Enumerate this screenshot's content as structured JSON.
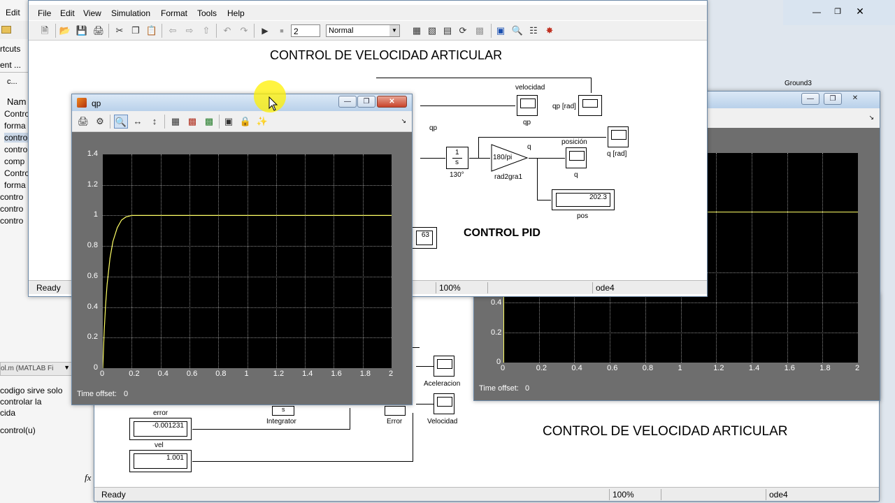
{
  "colors": {
    "plot_bg": "#000000",
    "trace": "#ffff66",
    "titlebar": "#c8daee"
  },
  "matlab": {
    "menu_edit": "Edit",
    "shortcuts": "rtcuts",
    "current_dir": "ent ...",
    "path_back": "c...",
    "col_name": "Nam",
    "files": [
      "Contro",
      "forma",
      "contro",
      "contro",
      "comp",
      "Contro",
      "forma",
      "contro",
      "contro",
      "contro"
    ],
    "editor_file": "ol.m (MATLAB Fi",
    "editor_lines": [
      "codigo sirve solo",
      "controlar la",
      "cida",
      "control(u)"
    ],
    "fx": "fx"
  },
  "model_top": {
    "menus": [
      "File",
      "Edit",
      "View",
      "Simulation",
      "Format",
      "Tools",
      "Help"
    ],
    "stop_time": "2",
    "sim_mode": "Normal",
    "title": "CONTROL DE VELOCIDAD ARTICULAR",
    "subtitle": "CONTROL PID",
    "status_ready": "Ready",
    "zoom": "100%",
    "solver": "ode4",
    "blocks": {
      "velocidad": "velocidad",
      "qp": "qp",
      "qp_rad": "qp [rad]",
      "qp_signal": "qp",
      "integ_num": "1",
      "integ_den": "s",
      "integ_label": "130°",
      "gain": "180/pi",
      "gain_label": "rad2gra1",
      "q_signal": "q",
      "posicion": "posición",
      "q": "q",
      "q_rad": "q [rad]",
      "pos_value": "202.3",
      "pos": "pos",
      "partial_value": "63"
    }
  },
  "ground3": "Ground3",
  "scope_qp": {
    "title": "qp",
    "time_offset_label": "Time offset:",
    "time_offset_value": "0"
  },
  "scope_right": {
    "time_offset_label": "Time offset:",
    "time_offset_value": "0",
    "y_ticks": [
      "0.4",
      "0.2",
      "0"
    ],
    "x_ticks": [
      "0",
      "0.2",
      "0.4",
      "0.6",
      "0.8",
      "1",
      "1.2",
      "1.4",
      "1.6",
      "1.8",
      "2"
    ]
  },
  "model_bottom": {
    "title": "CONTROL DE VELOCIDAD ARTICULAR",
    "error_label": "error",
    "error_value": "-0.001231",
    "vel_label": "vel",
    "vel_value": "1.001",
    "integrator_s": "s",
    "integrator": "Integrator",
    "error_block": "Error",
    "aceleracion": "Aceleracion",
    "velocidad": "Velocidad",
    "status_ready": "Ready",
    "zoom": "100%",
    "solver": "ode4"
  },
  "chart_data": {
    "type": "line",
    "title": "qp",
    "xlim": [
      0,
      2
    ],
    "ylim": [
      0,
      1.4
    ],
    "x_ticks": [
      "0",
      "0.2",
      "0.4",
      "0.6",
      "0.8",
      "1",
      "1.2",
      "1.4",
      "1.6",
      "1.8",
      "2"
    ],
    "y_ticks": [
      "0",
      "0.2",
      "0.4",
      "0.6",
      "0.8",
      "1",
      "1.2",
      "1.4"
    ],
    "grid": true,
    "series": [
      {
        "x": [
          0,
          0.01,
          0.02,
          0.03,
          0.05,
          0.07,
          0.1,
          0.13,
          0.16,
          0.2,
          0.3,
          0.5,
          1.0,
          1.5,
          2.0
        ],
        "y": [
          0,
          0.25,
          0.42,
          0.55,
          0.72,
          0.83,
          0.92,
          0.97,
          0.99,
          1.0,
          1.0,
          1.0,
          1.0,
          1.0,
          1.0
        ]
      }
    ]
  }
}
